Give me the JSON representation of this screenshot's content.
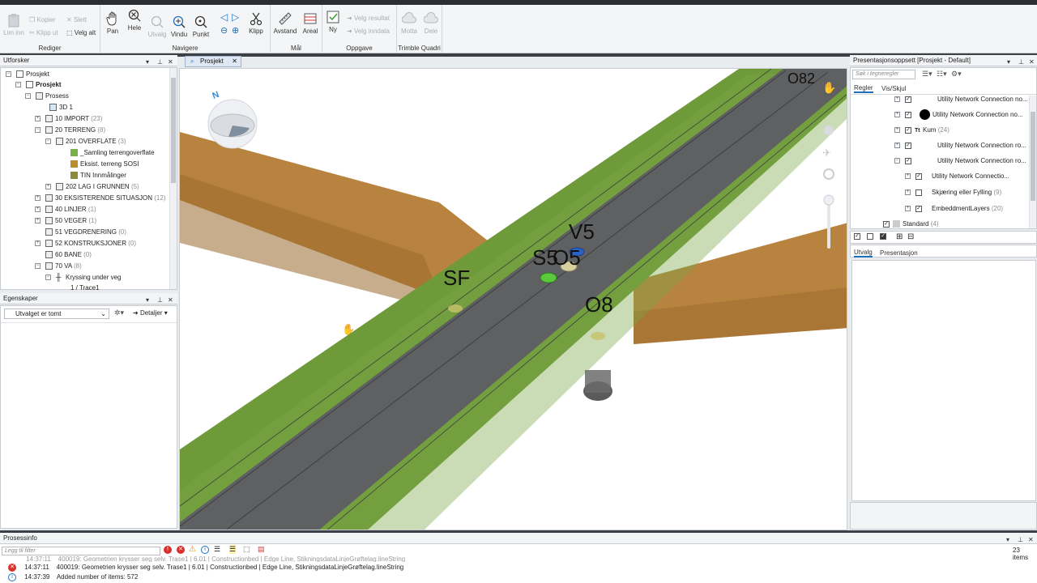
{
  "ribbon": {
    "groups": {
      "rediger": "Rediger",
      "navigere": "Navigere",
      "maal": "Mål",
      "oppgave": "Oppgave",
      "trimble": "Trimble Quadri"
    },
    "buttons": {
      "lim_inn": "Lim inn",
      "kopier": "Kopier",
      "klipp_ut": "Klipp ut",
      "slett": "Slett",
      "velg_alt": "Velg alt",
      "pan": "Pan",
      "hele": "Hele",
      "utvalg": "Utvalg",
      "vindu": "Vindu",
      "punkt": "Punkt",
      "klipp": "Klipp",
      "avstand": "Avstand",
      "areal": "Areal",
      "ny": "Ny",
      "velg_resultat": "Velg resultat",
      "velg_inndata": "Velg inndata",
      "motta": "Motta",
      "dele": "Dele"
    }
  },
  "explorer": {
    "title": "Utforsker",
    "items": [
      {
        "label": "Prosjekt",
        "count": ""
      },
      {
        "label": "Prosjekt",
        "count": ""
      },
      {
        "label": "Prosess",
        "count": ""
      },
      {
        "label": "3D 1",
        "count": ""
      },
      {
        "label": "10 IMPORT",
        "count": "(23)"
      },
      {
        "label": "20 TERRENG",
        "count": "(8)"
      },
      {
        "label": "201 OVERFLATE",
        "count": "(3)"
      },
      {
        "label": "_Samling terrengoverflate",
        "count": ""
      },
      {
        "label": "Eksist. terreng SOSI",
        "count": ""
      },
      {
        "label": "TIN Innmålinger",
        "count": ""
      },
      {
        "label": "202 LAG I GRUNNEN",
        "count": "(5)"
      },
      {
        "label": "30 EKSISTERENDE SITUASJON",
        "count": "(12)"
      },
      {
        "label": "40 LINJER",
        "count": "(1)"
      },
      {
        "label": "50 VEGER",
        "count": "(1)"
      },
      {
        "label": "51 VEGDRENERING",
        "count": "(0)"
      },
      {
        "label": "52 KONSTRUKSJONER",
        "count": "(0)"
      },
      {
        "label": "60 BANE",
        "count": "(0)"
      },
      {
        "label": "70 VA",
        "count": "(8)"
      },
      {
        "label": "Kryssing under veg",
        "count": ""
      },
      {
        "label": "1 / Trace1",
        "count": ""
      }
    ]
  },
  "properties": {
    "title": "Egenskaper",
    "selection": "Utvalget er tomt",
    "details": "Detaljer"
  },
  "viewport": {
    "tab": "Prosjekt",
    "compass_label": "N",
    "labels": {
      "v5": "V5",
      "s5": "S5",
      "o5": "O5",
      "sf": "SF",
      "o8": "O8",
      "o82": "O82"
    }
  },
  "presentation": {
    "title": "Presentasjonsoppsett [Prosjekt - Default]",
    "search_placeholder": "Søk i tegneregler",
    "tabs": {
      "regler": "Regler",
      "vis_skjul": "Vis/Skjul"
    },
    "rules": [
      {
        "label": "Utility Network Connection no...",
        "count": ""
      },
      {
        "label": "Utility Network Connection no...",
        "count": ""
      },
      {
        "label": "Kum",
        "count": "(24)"
      },
      {
        "label": "Utility Network Connection ro...",
        "count": ""
      },
      {
        "label": "Utility Network Connection ro...",
        "count": ""
      },
      {
        "label": "Utility Network Connectio...",
        "count": ""
      },
      {
        "label": "Skjæring eller Fylling",
        "count": "(9)"
      },
      {
        "label": "EmbeddmentLayers",
        "count": "(20)"
      },
      {
        "label": "Standard",
        "count": "(4)"
      }
    ],
    "bottom_tabs": {
      "utvalg": "Utvalg",
      "presentasjon": "Presentasjon"
    }
  },
  "process_info": {
    "title": "Prosessinfo",
    "filter_placeholder": "Legg til filter",
    "items_count": "23 items",
    "rows": [
      {
        "time": "14:37:11",
        "text": "400019: Geometrien krysser seg selv. Trase1 | 6.01 | Constructionbed | Edge Line, StikningsdataLinjeGrøftelag.lineString"
      },
      {
        "time": "14:37:11",
        "text": "400019: Geometrien krysser seg selv. Trase1 | 6.01 | Constructionbed | Edge Line, StikningsdataLinjeGrøftelag.lineString"
      },
      {
        "time": "14:37:39",
        "text": "Added number of items: 572"
      }
    ]
  },
  "colors": {
    "road": "#5f6062",
    "grass": "#6e9a3a",
    "earth": "#b8833f",
    "accent_blue": "#1f6fbf",
    "error_red": "#d9302c"
  }
}
